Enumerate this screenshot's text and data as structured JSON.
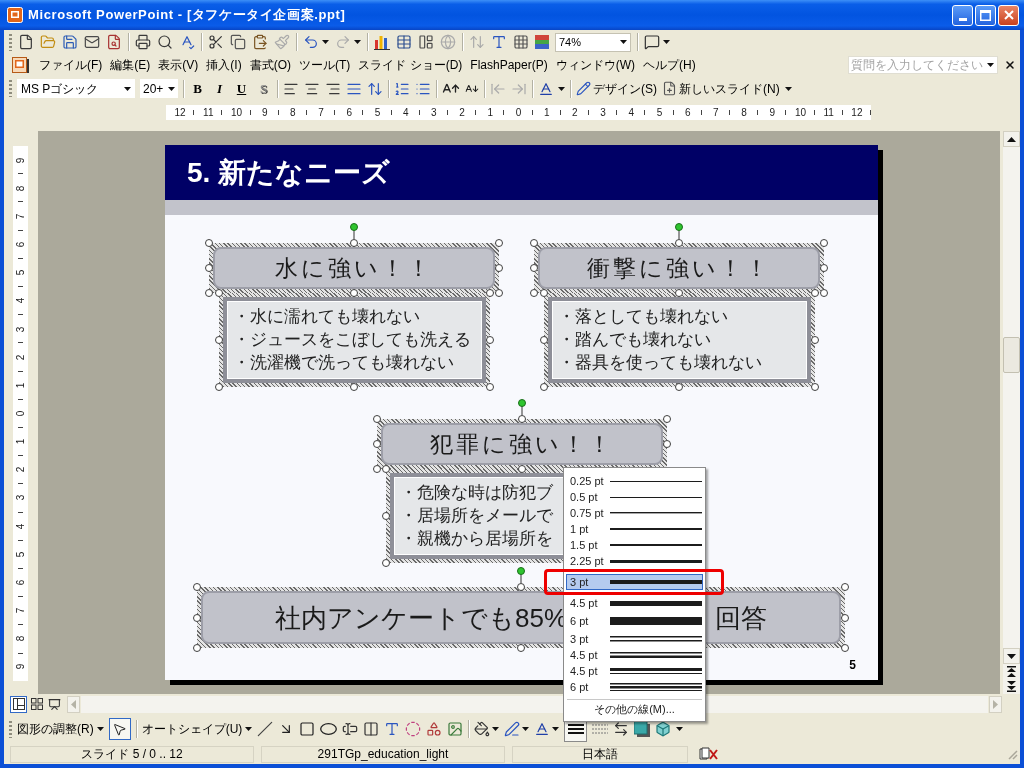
{
  "window": {
    "title": "Microsoft PowerPoint - [タフケータイ企画案.ppt]"
  },
  "standard_toolbar": {
    "zoom": "74%"
  },
  "menu_bar": {
    "items": [
      "ファイル(F)",
      "編集(E)",
      "表示(V)",
      "挿入(I)",
      "書式(O)",
      "ツール(T)",
      "スライド ショー(D)",
      "FlashPaper(P)",
      "ウィンドウ(W)",
      "ヘルプ(H)"
    ],
    "help_search": {
      "placeholder": "質問を入力してください"
    }
  },
  "formatting_toolbar": {
    "font": "MS Pゴシック",
    "font_size": "20+",
    "style_buttons": [
      {
        "label": "B",
        "kind": "bold"
      },
      {
        "label": "I",
        "kind": "italic"
      },
      {
        "label": "U",
        "kind": "underline"
      },
      {
        "label": "S",
        "kind": "shadow"
      }
    ],
    "buttons": [
      "デザイン(S)",
      "新しいスライド(N)"
    ]
  },
  "horizontal_ruler": [
    "12",
    "11",
    "10",
    "9",
    "8",
    "7",
    "6",
    "5",
    "4",
    "3",
    "2",
    "1",
    "0",
    "1",
    "2",
    "3",
    "4",
    "5",
    "6",
    "7",
    "8",
    "9",
    "10",
    "11",
    "12"
  ],
  "vertical_ruler": [
    "9",
    "8",
    "7",
    "6",
    "5",
    "4",
    "3",
    "2",
    "1",
    "0",
    "1",
    "2",
    "3",
    "4",
    "5",
    "6",
    "7",
    "8",
    "9"
  ],
  "slide": {
    "title": "5. 新たなニーズ",
    "groups": [
      {
        "heading": "水に強い！！",
        "bullets": [
          "・水に濡れても壊れない",
          "・ジュースをこぼしても洗える",
          "・洗濯機で洗っても壊れない"
        ],
        "selected": true
      },
      {
        "heading": "衝撃に強い！！",
        "bullets": [
          "・落としても壊れない",
          "・踏んでも壊れない",
          "・器具を使っても壊れない"
        ],
        "selected": true
      },
      {
        "heading": "犯罪に強い！！",
        "bullets": [
          "・危険な時は防犯ブ",
          "・居場所をメールで",
          "・親機から居場所を"
        ],
        "selected": true
      }
    ],
    "banner": {
      "parts": [
        "社内アンケートでも85%",
        "回答"
      ],
      "selected": true
    },
    "number": "5"
  },
  "line_weight_menu": {
    "items": [
      {
        "label": "0.25 pt",
        "kind": "hairline",
        "selected": false,
        "annotated": false
      },
      {
        "label": "0.5 pt",
        "kind": "fine",
        "selected": false,
        "annotated": false
      },
      {
        "label": "0.75 pt",
        "kind": "light",
        "selected": false,
        "annotated": false
      },
      {
        "label": "1 pt",
        "kind": "regular",
        "selected": false,
        "annotated": false
      },
      {
        "label": "1.5 pt",
        "kind": "medium",
        "selected": false,
        "annotated": false
      },
      {
        "label": "2.25 pt",
        "kind": "semibold",
        "selected": false,
        "annotated": false
      },
      {
        "label": "3 pt",
        "kind": "bold",
        "selected": true,
        "annotated": true
      },
      {
        "label": "4.5 pt",
        "kind": "heavy",
        "selected": false,
        "annotated": false
      },
      {
        "label": "6 pt",
        "kind": "black",
        "selected": false,
        "annotated": false
      },
      {
        "label": "3 pt",
        "kind": "double",
        "selected": false,
        "annotated": false
      },
      {
        "label": "4.5 pt",
        "kind": "thinthick",
        "selected": false,
        "annotated": false
      },
      {
        "label": "4.5 pt",
        "kind": "thickthin",
        "selected": false,
        "annotated": false
      },
      {
        "label": "6 pt",
        "kind": "triple",
        "selected": false,
        "annotated": false
      }
    ],
    "more": "その他の線(M)..."
  },
  "view_buttons": [
    {
      "kind": "normal",
      "selected": true
    },
    {
      "kind": "sorter",
      "selected": false
    },
    {
      "kind": "slideshow",
      "selected": false
    }
  ],
  "drawing_toolbar": {
    "menus": [
      "図形の調整(R)",
      "オートシェイプ(U)"
    ],
    "pointer_selected": true,
    "line_style_open": true
  },
  "status_bar": {
    "slide_position": "スライド 5 / 0 .. 12",
    "design": "291TGp_education_light",
    "language": "日本語"
  }
}
